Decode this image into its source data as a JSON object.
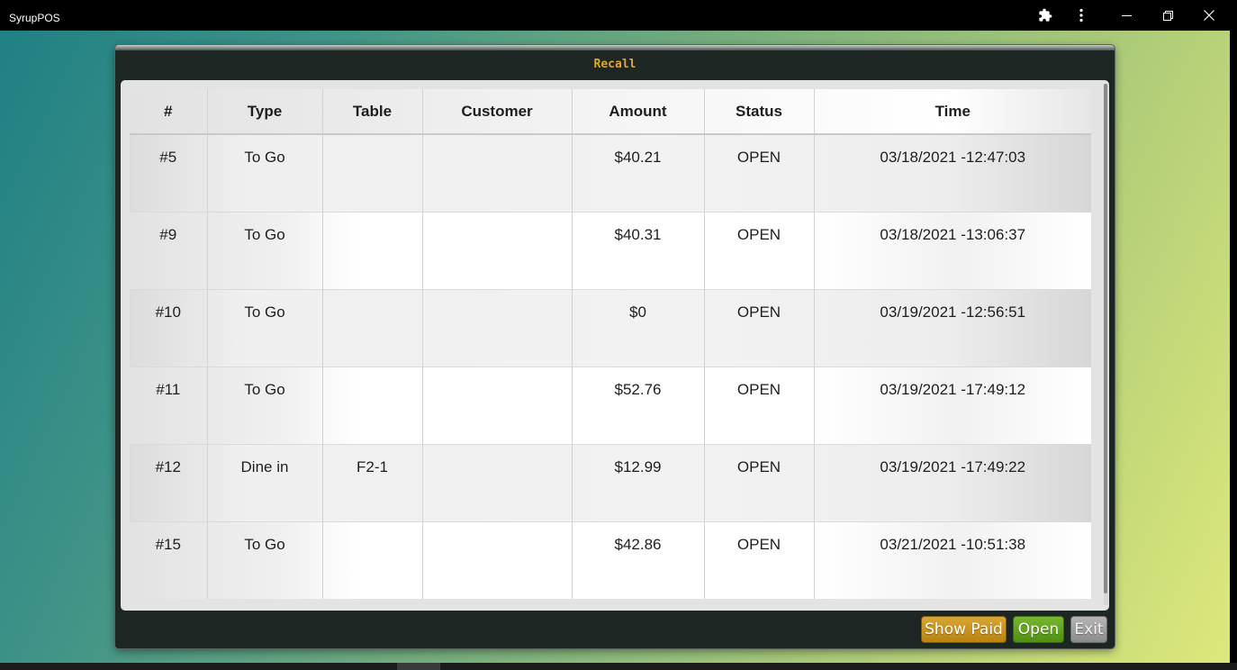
{
  "window": {
    "title": "SyrupPOS",
    "icons": [
      "puzzle-icon",
      "more-vert-icon",
      "minimize-icon",
      "restore-icon",
      "close-icon"
    ]
  },
  "dialog": {
    "title": "Recall",
    "columns": [
      "#",
      "Type",
      "Table",
      "Customer",
      "Amount",
      "Status",
      "Time"
    ],
    "rows": [
      {
        "num": "#5",
        "type": "To Go",
        "table": "",
        "customer": "",
        "amount": "$40.21",
        "status": "OPEN",
        "time": "03/18/2021 -12:47:03"
      },
      {
        "num": "#9",
        "type": "To Go",
        "table": "",
        "customer": "",
        "amount": "$40.31",
        "status": "OPEN",
        "time": "03/18/2021 -13:06:37"
      },
      {
        "num": "#10",
        "type": "To Go",
        "table": "",
        "customer": "",
        "amount": "$0",
        "status": "OPEN",
        "time": "03/19/2021 -12:56:51"
      },
      {
        "num": "#11",
        "type": "To Go",
        "table": "",
        "customer": "",
        "amount": "$52.76",
        "status": "OPEN",
        "time": "03/19/2021 -17:49:12"
      },
      {
        "num": "#12",
        "type": "Dine in",
        "table": "F2-1",
        "customer": "",
        "amount": "$12.99",
        "status": "OPEN",
        "time": "03/19/2021 -17:49:22"
      },
      {
        "num": "#15",
        "type": "To Go",
        "table": "",
        "customer": "",
        "amount": "$42.86",
        "status": "OPEN",
        "time": "03/21/2021 -10:51:38"
      }
    ],
    "buttons": {
      "show_paid": "Show Paid",
      "open": "Open",
      "exit": "Exit"
    }
  },
  "colors": {
    "title_accent": "#e0a52d",
    "show_paid": "#c8941f",
    "open": "#64a31f",
    "exit": "#a0a0a0"
  }
}
